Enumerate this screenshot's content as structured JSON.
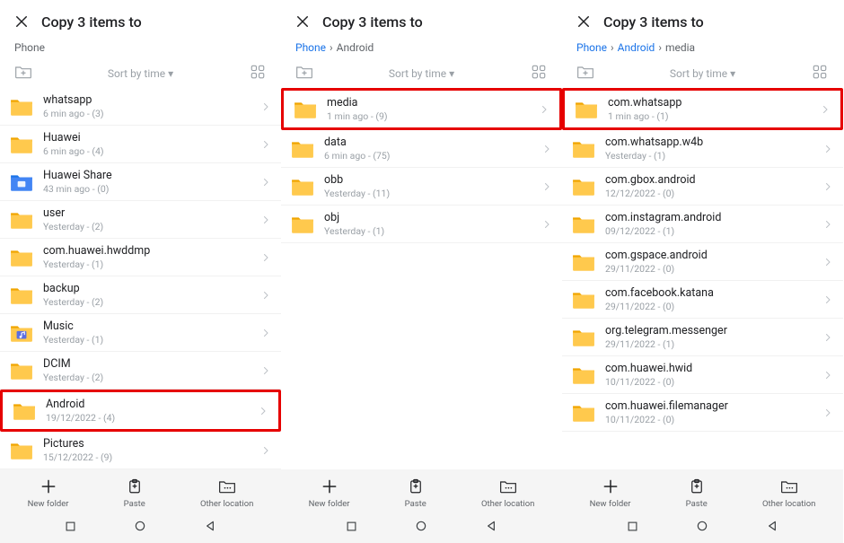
{
  "shared": {
    "title": "Copy 3 items to",
    "sort_label": "Sort by time ▾",
    "actions": {
      "new_folder": "New folder",
      "paste": "Paste",
      "other_location": "Other location"
    }
  },
  "panes": [
    {
      "breadcrumb": {
        "parts": [
          {
            "text": "Phone",
            "link": false
          }
        ]
      },
      "folders": [
        {
          "name": "whatsapp",
          "sub": "6 min ago - (3)",
          "icon": "folder"
        },
        {
          "name": "Huawei",
          "sub": "6 min ago - (4)",
          "icon": "folder"
        },
        {
          "name": "Huawei Share",
          "sub": "43 min ago - (0)",
          "icon": "folder-blue"
        },
        {
          "name": "user",
          "sub": "Yesterday - (2)",
          "icon": "folder"
        },
        {
          "name": "com.huawei.hwddmp",
          "sub": "Yesterday - (1)",
          "icon": "folder"
        },
        {
          "name": "backup",
          "sub": "Yesterday - (2)",
          "icon": "folder"
        },
        {
          "name": "Music",
          "sub": "Yesterday - (1)",
          "icon": "folder-music"
        },
        {
          "name": "DCIM",
          "sub": "Yesterday - (2)",
          "icon": "folder"
        },
        {
          "name": "Android",
          "sub": "19/12/2022 - (4)",
          "icon": "folder",
          "highlight": true
        },
        {
          "name": "Pictures",
          "sub": "15/12/2022 - (9)",
          "icon": "folder"
        }
      ]
    },
    {
      "breadcrumb": {
        "parts": [
          {
            "text": "Phone",
            "link": true
          },
          {
            "text": "Android",
            "link": false
          }
        ]
      },
      "folders": [
        {
          "name": "media",
          "sub": "1 min ago - (9)",
          "icon": "folder",
          "highlight": true
        },
        {
          "name": "data",
          "sub": "6 min ago - (75)",
          "icon": "folder"
        },
        {
          "name": "obb",
          "sub": "Yesterday - (11)",
          "icon": "folder"
        },
        {
          "name": "obj",
          "sub": "Yesterday - (1)",
          "icon": "folder"
        }
      ]
    },
    {
      "breadcrumb": {
        "parts": [
          {
            "text": "Phone",
            "link": true
          },
          {
            "text": "Android",
            "link": true
          },
          {
            "text": "media",
            "link": false
          }
        ]
      },
      "folders": [
        {
          "name": "com.whatsapp",
          "sub": "1 min ago - (1)",
          "icon": "folder",
          "highlight": true
        },
        {
          "name": "com.whatsapp.w4b",
          "sub": "Yesterday - (1)",
          "icon": "folder"
        },
        {
          "name": "com.gbox.android",
          "sub": "12/12/2022 - (0)",
          "icon": "folder"
        },
        {
          "name": "com.instagram.android",
          "sub": "09/12/2022 - (1)",
          "icon": "folder"
        },
        {
          "name": "com.gspace.android",
          "sub": "29/11/2022 - (0)",
          "icon": "folder"
        },
        {
          "name": "com.facebook.katana",
          "sub": "29/11/2022 - (0)",
          "icon": "folder"
        },
        {
          "name": "org.telegram.messenger",
          "sub": "29/11/2022 - (1)",
          "icon": "folder"
        },
        {
          "name": "com.huawei.hwid",
          "sub": "10/11/2022 - (0)",
          "icon": "folder"
        },
        {
          "name": "com.huawei.filemanager",
          "sub": "10/11/2022 - (0)",
          "icon": "folder"
        }
      ]
    }
  ]
}
